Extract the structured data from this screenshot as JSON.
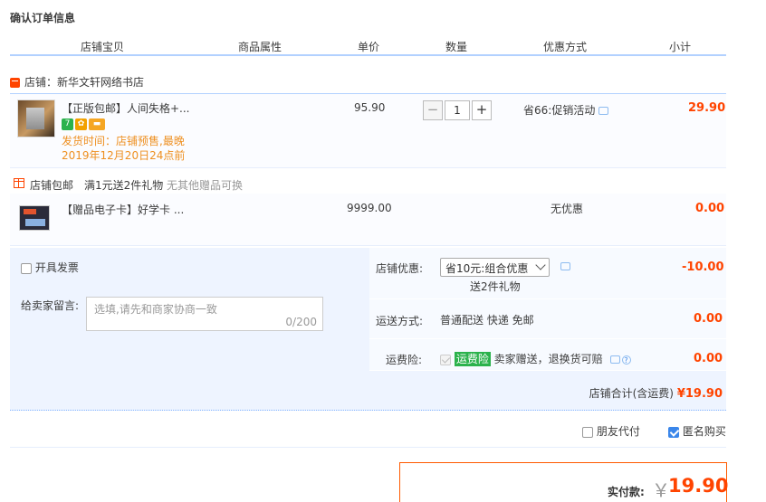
{
  "page": {
    "title": "确认订单信息"
  },
  "columns": [
    "店铺宝贝",
    "商品属性",
    "单价",
    "数量",
    "优惠方式",
    "小计"
  ],
  "shop": {
    "label": "店铺：新华文轩网络书店"
  },
  "item1": {
    "title": "【正版包邮】人间失格+...",
    "shipping_line1": "发货时间：店铺预售,最晚",
    "shipping_line2": "2019年12月20日24点前",
    "price": "95.90",
    "quantity": "1",
    "minus": "−",
    "plus": "+",
    "promo": "省66:促销活动",
    "subtotal": "29.90",
    "badges": [
      "7",
      "✿",
      "▬"
    ]
  },
  "gift_promo": {
    "label": "店铺包邮",
    "text": "满1元送2件礼物",
    "note": "无其他赠品可换"
  },
  "item2": {
    "title": "【赠品电子卡】好学卡 ...",
    "price": "9999.00",
    "promo": "无优惠",
    "subtotal": "0.00"
  },
  "invoice": {
    "label": "开具发票",
    "checked": false
  },
  "memo": {
    "label": "给卖家留言:",
    "placeholder": "选填,请先和商家协商一致",
    "count": "0/200"
  },
  "store_discount": {
    "label": "店铺优惠:",
    "selected": "省10元:组合优惠",
    "note": "送2件礼物",
    "amount": "-10.00"
  },
  "delivery": {
    "label": "运送方式:",
    "value": "普通配送 快递 免邮",
    "amount": "0.00"
  },
  "freight_insurance": {
    "label": "运费险:",
    "tag": "运费险",
    "text": "卖家赠送，退换货可赔",
    "amount": "0.00",
    "checked": true
  },
  "store_total": {
    "label": "店铺合计(含运费)",
    "amount": "¥19.90"
  },
  "options": {
    "friend_pay": "朋友代付",
    "friend_pay_checked": false,
    "anonymous": "匿名购买",
    "anonymous_checked": true
  },
  "payment": {
    "label": "实付款:",
    "currency": "￥",
    "amount": "19.90"
  },
  "colors": {
    "accent": "#ff4400",
    "border": "#b2d1ff",
    "panel": "#eef4ff",
    "promo_text": "#ee9022",
    "green": "#2bb24c"
  }
}
